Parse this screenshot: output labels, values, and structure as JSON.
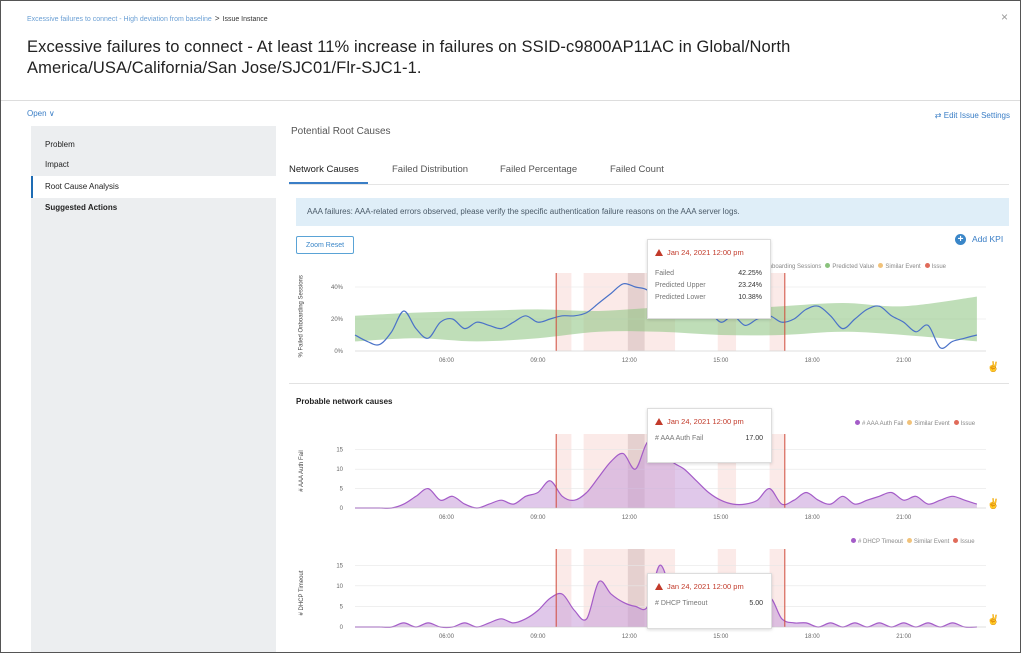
{
  "header": {
    "breadcrumb_parent": "Excessive failures to connect - High deviation from baseline",
    "breadcrumb_sep": ">",
    "breadcrumb_current": "Issue Instance",
    "close_glyph": "×",
    "title": "Excessive failures to connect - At least 11% increase in failures on SSID-c9800AP11AC in Global/North America/USA/California/San Jose/SJC01/Flr-SJC1-1."
  },
  "toolbar": {
    "status": "Open",
    "status_chevron": "∨",
    "edit_settings": "Edit Issue Settings",
    "edit_icon": "⇄"
  },
  "sidebar": {
    "items": [
      {
        "label": "Problem"
      },
      {
        "label": "Impact"
      },
      {
        "label": "Root Cause Analysis"
      },
      {
        "label": "Suggested Actions"
      }
    ],
    "active_index": 2
  },
  "main": {
    "section_title": "Potential Root Causes",
    "tabs": [
      {
        "label": "Network Causes"
      },
      {
        "label": "Failed Distribution"
      },
      {
        "label": "Failed Percentage"
      },
      {
        "label": "Failed Count"
      }
    ],
    "info_message": "AAA failures: AAA-related errors observed, please verify the specific authentication failure reasons on the AAA server logs.",
    "zoom_reset": "Zoom Reset",
    "add_kpi": "Add KPI",
    "add_kpi_icon": "+",
    "probable_title": "Probable network causes"
  },
  "colors": {
    "accent": "#3a7ec6",
    "issue_red": "#d04a3a",
    "similar_event": "#f1c27a",
    "predicted_green": "#8ac27d",
    "line_blue": "#4a72c8",
    "purple": "#a45cc8"
  },
  "tooltips": {
    "top": {
      "header": "Jan 24, 2021 12:00 pm",
      "rows": [
        {
          "label": "Failed",
          "value": "42.25%"
        },
        {
          "label": "Predicted Upper",
          "value": "23.24%"
        },
        {
          "label": "Predicted Lower",
          "value": "10.38%"
        }
      ]
    },
    "aaa": {
      "header": "Jan 24, 2021 12:00 pm",
      "rows": [
        {
          "label": "# AAA Auth Fail",
          "value": "17.00"
        }
      ]
    },
    "dhcp": {
      "header": "Jan 24, 2021 12:00 pm",
      "rows": [
        {
          "label": "# DHCP Timeout",
          "value": "5.00"
        }
      ]
    }
  },
  "legends": {
    "top": {
      "partial": "iled Onboarding Sessions",
      "predicted": "Predicted Value",
      "similar": "Similar Event",
      "issue": "Issue"
    },
    "aaa": {
      "series": "# AAA Auth Fail",
      "similar": "Similar Event",
      "issue": "Issue"
    },
    "dhcp": {
      "series": "# DHCP Timeout",
      "similar": "Similar Event",
      "issue": "Issue"
    }
  },
  "chart_data": [
    {
      "type": "line",
      "ylabel": "% Failed Onboarding Sessions",
      "ylim": [
        0,
        45
      ],
      "yticks": [
        "0%",
        "20%",
        "40%"
      ],
      "ytick_values": [
        0,
        20,
        40
      ],
      "xticks": [
        "06:00",
        "09:00",
        "12:00",
        "15:00",
        "18:00",
        "21:00"
      ],
      "xtick_values": [
        6,
        9,
        12,
        15,
        18,
        21
      ],
      "xlim": [
        3,
        23.7
      ],
      "issue_lines": [
        9.6,
        17.1
      ],
      "similar_bands": [
        [
          9.6,
          10.1
        ],
        [
          10.5,
          13.5
        ],
        [
          14.9,
          15.5
        ],
        [
          16.6,
          17.1
        ]
      ],
      "series": [
        {
          "name": "% Failed Onboarding Sessions",
          "x": [
            3.0,
            3.4,
            3.8,
            4.2,
            4.6,
            5.0,
            5.4,
            5.8,
            6.2,
            6.6,
            7.0,
            7.4,
            7.8,
            8.2,
            8.6,
            9.0,
            9.4,
            9.8,
            10.2,
            10.6,
            11.0,
            11.4,
            11.8,
            12.2,
            12.6,
            13.0,
            13.4,
            13.8,
            14.2,
            14.6,
            15.0,
            15.4,
            15.8,
            16.2,
            16.6,
            17.0,
            17.4,
            17.8,
            18.2,
            18.6,
            19.0,
            19.4,
            19.8,
            20.2,
            20.6,
            21.0,
            21.4,
            21.8,
            22.2,
            22.6,
            23.0,
            23.4
          ],
          "values": [
            10,
            6,
            4,
            12,
            25,
            14,
            8,
            18,
            20,
            14,
            18,
            16,
            14,
            18,
            22,
            18,
            20,
            22,
            22,
            24,
            30,
            36,
            42,
            40,
            38,
            30,
            28,
            32,
            34,
            26,
            18,
            22,
            16,
            20,
            22,
            18,
            20,
            26,
            28,
            22,
            14,
            20,
            26,
            28,
            22,
            18,
            12,
            16,
            2,
            6,
            8,
            10
          ]
        },
        {
          "name": "Predicted Value",
          "x": [
            3.0,
            5.0,
            7.0,
            9.0,
            11.0,
            13.0,
            15.0,
            17.0,
            19.0,
            21.0,
            23.4
          ],
          "upper": [
            22,
            24,
            25,
            26,
            25,
            27,
            26,
            28,
            30,
            28,
            34
          ],
          "lower": [
            6,
            8,
            6,
            8,
            12,
            12,
            10,
            10,
            12,
            10,
            6
          ]
        }
      ]
    },
    {
      "type": "area",
      "ylabel": "# AAA Auth Fail",
      "ylim": [
        0,
        17.5
      ],
      "yticks": [
        "0",
        "5",
        "10",
        "15"
      ],
      "ytick_values": [
        0,
        5,
        10,
        15
      ],
      "xticks": [
        "06:00",
        "09:00",
        "12:00",
        "15:00",
        "18:00",
        "21:00"
      ],
      "xtick_values": [
        6,
        9,
        12,
        15,
        18,
        21
      ],
      "xlim": [
        3,
        23.7
      ],
      "issue_lines": [
        9.6,
        17.1
      ],
      "similar_bands": [
        [
          9.6,
          10.1
        ],
        [
          10.5,
          13.5
        ],
        [
          14.9,
          15.5
        ],
        [
          16.6,
          17.1
        ]
      ],
      "series": [
        {
          "name": "# AAA Auth Fail",
          "x": [
            3.0,
            3.4,
            3.8,
            4.2,
            4.6,
            5.0,
            5.4,
            5.8,
            6.2,
            6.6,
            7.0,
            7.4,
            7.8,
            8.2,
            8.6,
            9.0,
            9.4,
            9.8,
            10.2,
            10.6,
            11.0,
            11.4,
            11.8,
            12.2,
            12.6,
            13.0,
            13.4,
            13.8,
            14.2,
            14.6,
            15.0,
            15.4,
            15.8,
            16.2,
            16.6,
            17.0,
            17.4,
            17.8,
            18.2,
            18.6,
            19.0,
            19.4,
            19.8,
            20.2,
            20.6,
            21.0,
            21.4,
            21.8,
            22.2,
            22.6,
            23.0,
            23.4
          ],
          "values": [
            0,
            0,
            0,
            0,
            1,
            3,
            5,
            2,
            3,
            1,
            0,
            1,
            2,
            1,
            3,
            4,
            7,
            3,
            2,
            4,
            8,
            12,
            14,
            10,
            17,
            16,
            12,
            10,
            7,
            4,
            2,
            1,
            1,
            2,
            5,
            1,
            2,
            4,
            2,
            1,
            3,
            1,
            2,
            3,
            4,
            2,
            3,
            1,
            2,
            3,
            2,
            1
          ]
        }
      ]
    },
    {
      "type": "area",
      "ylabel": "# DHCP Timeout",
      "ylim": [
        0,
        17.5
      ],
      "yticks": [
        "0",
        "5",
        "10",
        "15"
      ],
      "ytick_values": [
        0,
        5,
        10,
        15
      ],
      "xticks": [
        "06:00",
        "09:00",
        "12:00",
        "15:00",
        "18:00",
        "21:00"
      ],
      "xtick_values": [
        6,
        9,
        12,
        15,
        18,
        21
      ],
      "xlim": [
        3,
        23.7
      ],
      "issue_lines": [
        9.6,
        17.1
      ],
      "similar_bands": [
        [
          9.6,
          10.1
        ],
        [
          10.5,
          13.5
        ],
        [
          14.9,
          15.5
        ],
        [
          16.6,
          17.1
        ]
      ],
      "series": [
        {
          "name": "# DHCP Timeout",
          "x": [
            3.0,
            3.4,
            3.8,
            4.2,
            4.6,
            5.0,
            5.4,
            5.8,
            6.2,
            6.6,
            7.0,
            7.4,
            7.8,
            8.2,
            8.6,
            9.0,
            9.4,
            9.8,
            10.2,
            10.6,
            11.0,
            11.4,
            11.8,
            12.2,
            12.6,
            13.0,
            13.4,
            13.8,
            14.2,
            14.6,
            15.0,
            15.4,
            15.8,
            16.2,
            16.6,
            17.0,
            17.4,
            17.8,
            18.2,
            18.6,
            19.0,
            19.4,
            19.8,
            20.2,
            20.6,
            21.0,
            21.4,
            21.8,
            22.2,
            22.6,
            23.0,
            23.4
          ],
          "values": [
            0,
            0,
            0,
            0,
            1,
            0,
            1,
            0,
            0,
            1,
            0,
            1,
            2,
            1,
            2,
            4,
            7,
            8,
            4,
            2,
            11,
            8,
            6,
            5,
            5,
            15,
            8,
            4,
            6,
            2,
            1,
            0,
            1,
            0,
            7,
            2,
            1,
            1,
            0,
            1,
            0,
            1,
            0,
            1,
            0,
            1,
            0,
            1,
            0,
            1,
            0,
            0
          ]
        }
      ]
    }
  ]
}
